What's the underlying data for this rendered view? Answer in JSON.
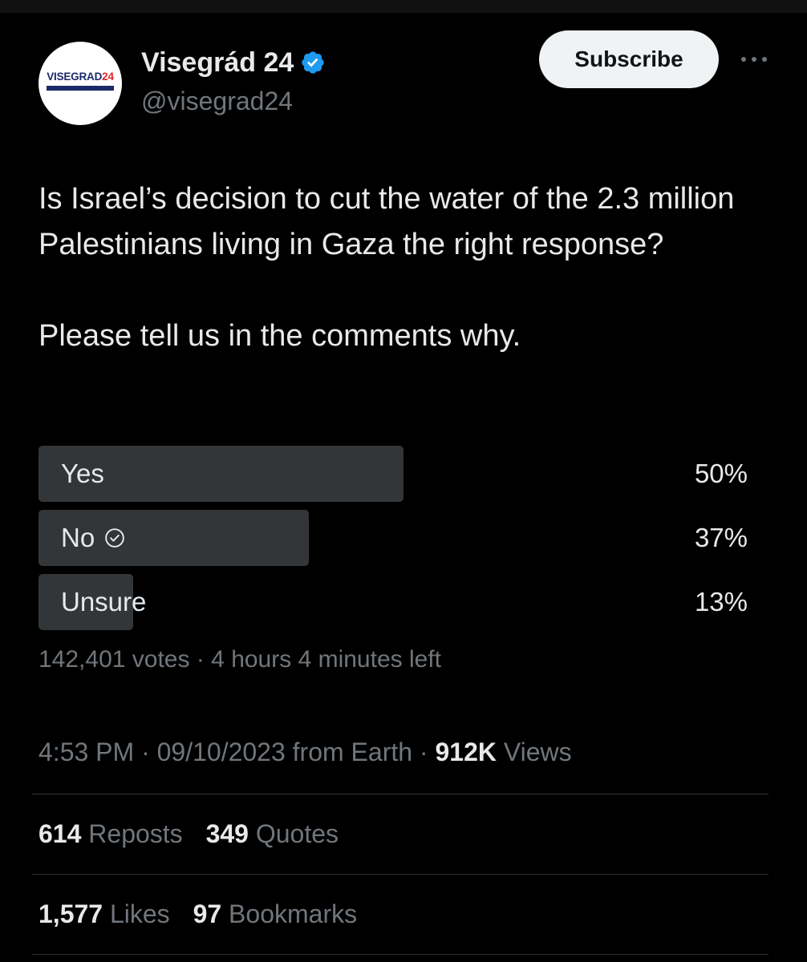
{
  "author": {
    "display_name": "Visegrád 24",
    "handle": "@visegrad24",
    "avatar": {
      "logo_part1": "VISEGRAD",
      "logo_part2": "24"
    },
    "verified": true,
    "verified_color": "#1d9bf0"
  },
  "header": {
    "subscribe_label": "Subscribe",
    "more_icon": "more-horizontal-icon"
  },
  "tweet": {
    "text_paragraph_1": "Is Israel’s decision to cut the water of the 2.3 million Palestinians living in Gaza the right response?",
    "text_paragraph_2": "Please tell us in the comments why."
  },
  "poll": {
    "options": [
      {
        "label": "Yes",
        "percent_text": "50%",
        "percent": 50,
        "selected": false
      },
      {
        "label": "No",
        "percent_text": "37%",
        "percent": 37,
        "selected": true
      },
      {
        "label": "Unsure",
        "percent_text": "13%",
        "percent": 13,
        "selected": false
      }
    ],
    "votes_text": "142,401 votes",
    "separator": "·",
    "time_left": "4 hours 4 minutes left"
  },
  "meta": {
    "time": "4:53 PM",
    "date": "09/10/2023",
    "source": "from Earth",
    "views_count": "912K",
    "views_label": "Views",
    "separator": "·"
  },
  "stats": {
    "reposts_count": "614",
    "reposts_label": "Reposts",
    "quotes_count": "349",
    "quotes_label": "Quotes",
    "likes_count": "1,577",
    "likes_label": "Likes",
    "bookmarks_count": "97",
    "bookmarks_label": "Bookmarks"
  },
  "colors": {
    "background": "#000000",
    "text": "#e7e9ea",
    "secondary_text": "#71767b",
    "poll_bar": "#333639",
    "divider": "#2f3336",
    "verified_badge": "#1d9bf0"
  }
}
